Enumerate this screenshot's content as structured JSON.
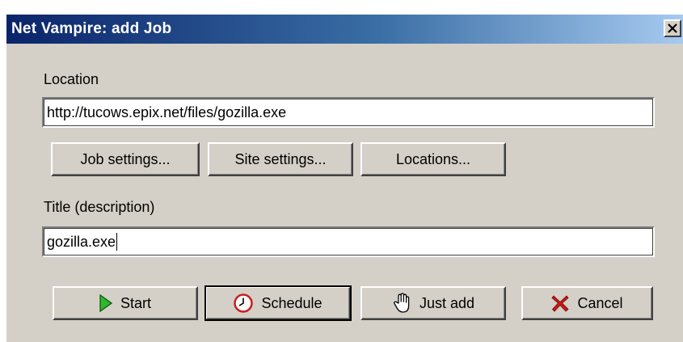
{
  "window": {
    "title": "Net Vampire: add Job"
  },
  "location": {
    "label": "Location",
    "value": "http://tucows.epix.net/files/gozilla.exe"
  },
  "settings_buttons": {
    "job_settings": "Job settings...",
    "site_settings": "Site settings...",
    "locations": "Locations..."
  },
  "title_field": {
    "label": "Title (description)",
    "value": "gozilla.exe"
  },
  "action_buttons": {
    "start": "Start",
    "schedule": "Schedule",
    "just_add": "Just add",
    "cancel": "Cancel"
  },
  "icons": {
    "start": "play-triangle-icon",
    "schedule": "clock-icon",
    "just_add": "hand-pointer-icon",
    "cancel": "red-x-icon",
    "close": "close-icon"
  },
  "colors": {
    "titlebar_start": "#0a246a",
    "titlebar_end": "#a6caf0",
    "face": "#d4d0c8",
    "start_icon": "#2eb82e",
    "cancel_icon": "#cc1a1a"
  }
}
